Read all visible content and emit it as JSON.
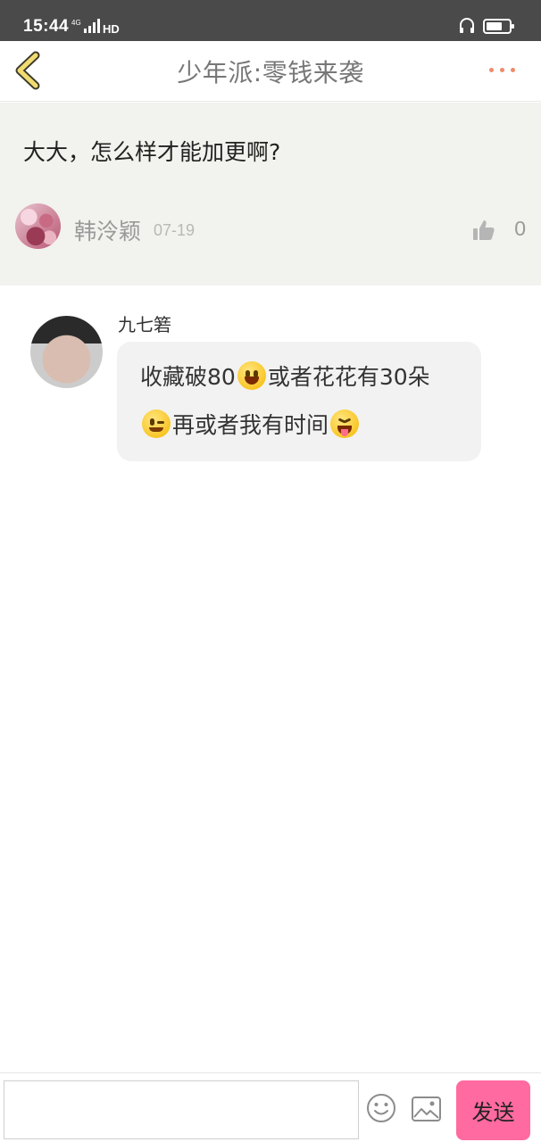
{
  "status_bar": {
    "time": "15:44",
    "network_label": "4G",
    "hd_label": "HD"
  },
  "header": {
    "title": "少年派:零钱来袭",
    "back_icon": "chevron-left-icon",
    "more_icon": "more-dots-icon",
    "accent_color": "#f08a6a"
  },
  "question": {
    "text": "大大，怎么样才能加更啊?",
    "author": "韩泠颖",
    "date": "07-19",
    "like_count": "0",
    "like_icon": "thumbs-up-icon"
  },
  "reply": {
    "name": "九七箬",
    "line1_a": "收藏破80",
    "line1_b": "或者花花有30朵",
    "line2_b": "再或者我有时间",
    "emojis": [
      "smile-emoji",
      "wink-emoji",
      "tongue-emoji"
    ]
  },
  "bottom_bar": {
    "input_value": "",
    "input_placeholder": "",
    "emoji_icon": "emoji-icon",
    "image_icon": "image-icon",
    "send_label": "发送",
    "send_color": "#ff6aa0"
  }
}
